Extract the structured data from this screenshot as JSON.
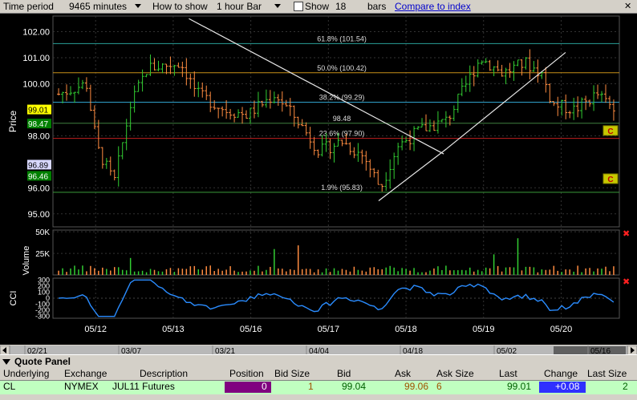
{
  "toolbar": {
    "time_period_label": "Time period",
    "time_period_value": "9465 minutes",
    "how_to_show_label": "How to show",
    "how_to_show_value": "1 hour Bar",
    "show_label": "Show",
    "show_count": "18",
    "bars_label": "bars",
    "compare_link": "Compare to index",
    "close_glyph": "✕"
  },
  "chart_data": {
    "type": "ohlc",
    "price_axis": {
      "label": "Price",
      "ticks": [
        "102.00",
        "101.00",
        "100.00",
        "98.00",
        "96.00",
        "95.00"
      ],
      "tick_values": [
        102,
        101,
        100,
        98,
        96,
        95
      ],
      "range": [
        94.5,
        102.6
      ],
      "price_tags": [
        {
          "text": "99.01",
          "value": 99.01,
          "bg": "#ffff00",
          "fg": "#000000"
        },
        {
          "text": "98.47",
          "value": 98.47,
          "bg": "#008000",
          "fg": "#ffffff"
        },
        {
          "text": "96.89",
          "value": 96.89,
          "bg": "#d8d8ff",
          "fg": "#000000"
        },
        {
          "text": "96.46",
          "value": 96.46,
          "bg": "#008000",
          "fg": "#ffffff"
        }
      ]
    },
    "fibonacci": [
      {
        "label": "61.8% (101.54)",
        "value": 101.54,
        "color": "#2aa198"
      },
      {
        "label": "50.0% (100.42)",
        "value": 100.42,
        "color": "#c89018"
      },
      {
        "label": "38.2% (99.29)",
        "value": 99.29,
        "color": "#30a0c8"
      },
      {
        "label": "23.6% (97.90)",
        "value": 97.9,
        "color": "#c02020"
      },
      {
        "label": "1.9% (95.83)",
        "value": 95.83,
        "color": "#3a9a3a"
      }
    ],
    "extra_line": {
      "label": "98.48",
      "value": 98.48,
      "color": "#408040"
    },
    "trendlines": [
      {
        "from": [
          0.24,
          102.5
        ],
        "to": [
          0.69,
          97.3
        ]
      },
      {
        "from": [
          0.575,
          95.5
        ],
        "to": [
          0.695,
          97.5
        ]
      },
      {
        "from": [
          0.695,
          97.5
        ],
        "to": [
          0.905,
          101.2
        ]
      }
    ],
    "markers": [
      {
        "text": "C",
        "value": 98.2
      },
      {
        "text": "C",
        "value": 96.35
      }
    ],
    "x_ticks": [
      "05/12",
      "05/13",
      "05/16",
      "05/17",
      "05/18",
      "05/19",
      "05/20"
    ],
    "volume_axis": {
      "label": "Volume",
      "ticks": [
        "50K",
        "25K"
      ],
      "tick_values": [
        50000,
        25000
      ],
      "range": [
        0,
        52000
      ]
    },
    "cci_axis": {
      "label": "CCI",
      "ticks": [
        "300",
        "200",
        "100",
        "0",
        "-100",
        "-200",
        "-300"
      ],
      "tick_values": [
        300,
        200,
        100,
        0,
        -100,
        -200,
        -300
      ],
      "range": [
        -330,
        330
      ]
    },
    "close_marker": "✖",
    "scrollbar_dates": [
      "02/21",
      "03/07",
      "03/21",
      "04/04",
      "04/18",
      "05/02",
      "05/16"
    ]
  },
  "quote_panel": {
    "title": "Quote Panel",
    "headers": [
      "Underlying",
      "Exchange",
      "Description",
      "Position",
      "Bid Size",
      "Bid",
      "Ask",
      "Ask Size",
      "Last",
      "Change",
      "Last Size"
    ],
    "row": {
      "underlying": "CL",
      "exchange": "NYMEX",
      "description": "JUL11 Futures",
      "position": "0",
      "bid_size": "1",
      "bid": "99.04",
      "ask": "99.06",
      "ask_size": "6",
      "last": "99.01",
      "change": "+0.08",
      "last_size": "2"
    },
    "colors": {
      "position_bg": "#800080",
      "change_bg": "#3030ff",
      "row_bg": "#c0ffc0",
      "scroll_fill": "#606060"
    }
  }
}
